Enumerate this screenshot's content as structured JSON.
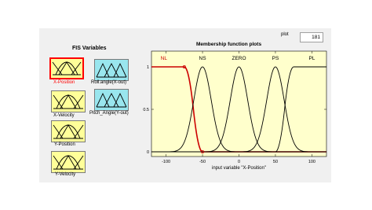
{
  "fis_panel": {
    "title": "FIS Variables",
    "inputs": [
      {
        "label": "X-Position",
        "selected": true
      },
      {
        "label": "X-Velocity",
        "selected": false
      },
      {
        "label": "Y-Position",
        "selected": false
      },
      {
        "label": "Y-Velocity",
        "selected": false
      }
    ],
    "outputs": [
      {
        "label": "Roll.angle(X-out)"
      },
      {
        "label": "Pitch_Angle(Y-out)"
      }
    ]
  },
  "mf_panel": {
    "title": "Membership function plots",
    "plot_points_label": "plot",
    "plot_points_value": "181",
    "xlabel": "input variable \"X-Position\"",
    "x_ticks": [
      "-100",
      "-50",
      "0",
      "50",
      "100"
    ],
    "y_ticks": [
      "1",
      "0.5",
      "0"
    ]
  },
  "chart_data": {
    "type": "line",
    "xlabel": "input variable \"X-Position\"",
    "xlim": [
      -120,
      120
    ],
    "ylim": [
      0,
      1
    ],
    "x_ticks": [
      -100,
      -50,
      0,
      50,
      100
    ],
    "y_ticks": [
      0,
      0.5,
      1
    ],
    "series": [
      {
        "name": "NL",
        "shape": "zmf",
        "params": [
          -75,
          -50
        ],
        "selected": true
      },
      {
        "name": "NS",
        "shape": "gaussmf",
        "params": [
          12,
          -50
        ]
      },
      {
        "name": "ZERO",
        "shape": "gaussmf",
        "params": [
          12,
          0
        ]
      },
      {
        "name": "PS",
        "shape": "gaussmf",
        "params": [
          12,
          50
        ]
      },
      {
        "name": "PL",
        "shape": "smf",
        "params": [
          50,
          75
        ]
      }
    ]
  },
  "colors": {
    "selected": "#cc0000",
    "curve": "#000000",
    "plot_bg": "#ffffcc",
    "input_var_bg": "#ffff99",
    "output_var_bg": "#99e6ee"
  }
}
